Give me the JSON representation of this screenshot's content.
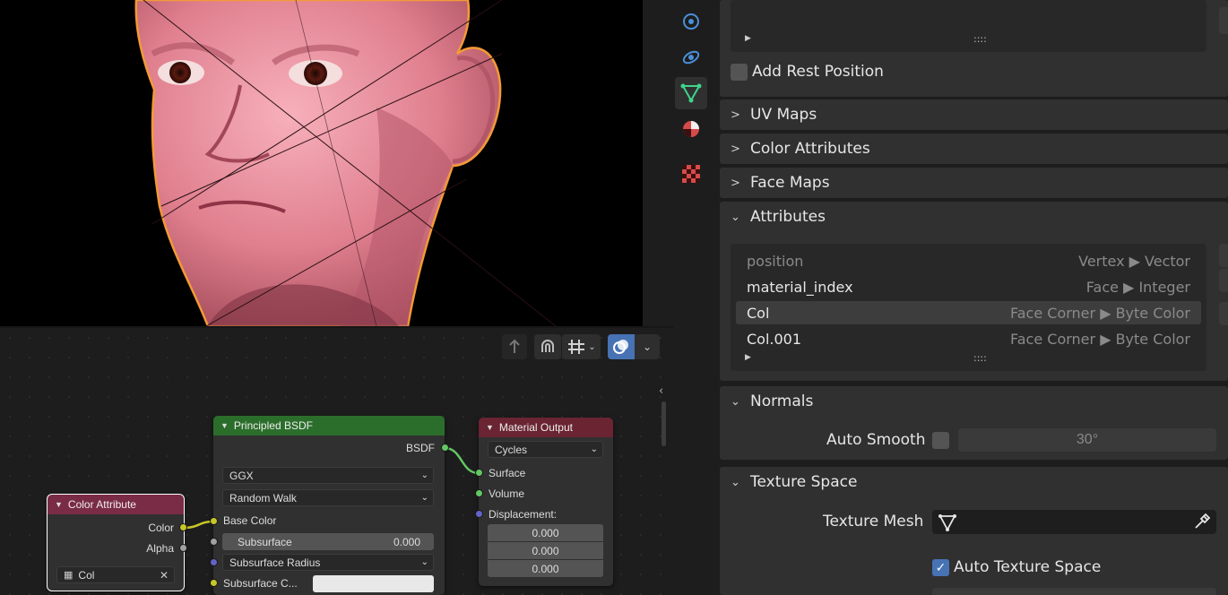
{
  "node_editor": {
    "nodes": {
      "color_attribute": {
        "title": "Color Attribute",
        "outputs": [
          "Color",
          "Alpha"
        ],
        "layer_value": "Col"
      },
      "principled": {
        "title": "Principled BSDF",
        "output": "BSDF",
        "distribution": "GGX",
        "subsurface_method": "Random Walk",
        "base_color_label": "Base Color",
        "subsurface_label": "Subsurface",
        "subsurface_value": "0.000",
        "subsurface_radius_label": "Subsurface Radius",
        "subsurface_color_label": "Subsurface C..."
      },
      "material_output": {
        "title": "Material Output",
        "target": "Cycles",
        "inputs": [
          "Surface",
          "Volume",
          "Displacement:"
        ],
        "vector_values": [
          "0.000",
          "0.000",
          "0.000"
        ]
      }
    },
    "colors": {
      "color_node_header": "#7a2b45",
      "shader_node_header": "#2b6e2b",
      "output_node_header": "#6a2432"
    }
  },
  "properties": {
    "add_rest_position_label": "Add Rest Position",
    "sections": {
      "uv_maps": "UV Maps",
      "color_attributes": "Color Attributes",
      "face_maps": "Face Maps",
      "attributes": "Attributes",
      "normals": "Normals",
      "texture_space": "Texture Space"
    },
    "attributes": [
      {
        "name": "position",
        "type": "Vertex ▶ Vector"
      },
      {
        "name": "material_index",
        "type": "Face ▶ Integer"
      },
      {
        "name": "Col",
        "type": "Face Corner ▶ Byte Color"
      },
      {
        "name": "Col.001",
        "type": "Face Corner ▶ Byte Color"
      }
    ],
    "list_grip": "::::",
    "expand_glyph": "▶",
    "auto_smooth_label": "Auto Smooth",
    "auto_smooth_angle": "30°",
    "texture_mesh_label": "Texture Mesh",
    "auto_texture_space_label": "Auto Texture Space",
    "accent": "#4772b3"
  }
}
